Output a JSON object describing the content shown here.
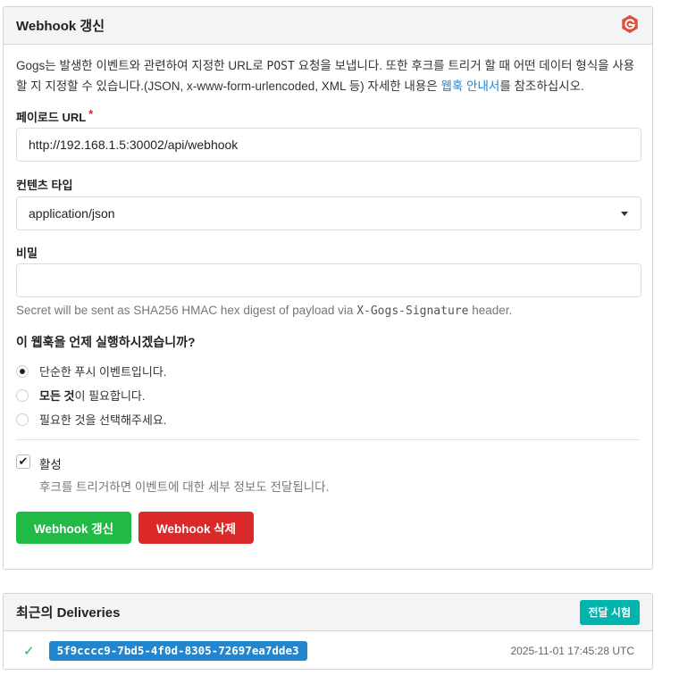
{
  "settings": {
    "title": "Webhook 갱신",
    "logo_icon": "gogs-logo-icon",
    "description": {
      "part1": "Gogs는 발생한 이벤트와 관련하여 지정한 URL로 ",
      "method": "POST",
      "part2": " 요청을 보냅니다. 또한 후크를 트리거 할 때 어떤 데이터 형식을 사용할 지 지정할 수 있습니다.(JSON, x-www-form-urlencoded, XML 등) 자세한 내용은 ",
      "link": "웹훅 안내서",
      "part3": "를 참조하십시오."
    },
    "payload_url": {
      "label": "페이로드 URL",
      "required_mark": "*",
      "value": "http://192.168.1.5:30002/api/webhook"
    },
    "content_type": {
      "label": "컨텐츠 타입",
      "value": "application/json"
    },
    "secret": {
      "label": "비밀",
      "value": "",
      "help_pre": "Secret will be sent as SHA256 HMAC hex digest of payload via ",
      "help_header": "X-Gogs-Signature",
      "help_post": " header."
    },
    "trigger": {
      "question": "이 웹훅을 언제 실행하시겠습니까?",
      "push_only": "단순한 푸시 이벤트입니다.",
      "all_bold": "모든 것",
      "all_rest": "이 필요합니다.",
      "choose": "필요한 것을 선택해주세요.",
      "selected": "push_only"
    },
    "active": {
      "label": "활성",
      "checked": true,
      "help": "후크를 트리거하면 이벤트에 대한 세부 정보도 전달됩니다."
    },
    "update_button": "Webhook 갱신",
    "delete_button": "Webhook 삭제"
  },
  "deliveries": {
    "title": "최근의 Deliveries",
    "test_button": "전달 시험",
    "items": [
      {
        "status_icon": "checkmark-icon",
        "uuid": "5f9cccc9-7bd5-4f0d-8305-72697ea7dde3",
        "time": "2025-11-01 17:45:28 UTC"
      }
    ]
  },
  "colors": {
    "green": "#21ba45",
    "red": "#db2828",
    "blue": "#2185d0",
    "teal": "#00b5ad",
    "logo": "#e04e39"
  }
}
